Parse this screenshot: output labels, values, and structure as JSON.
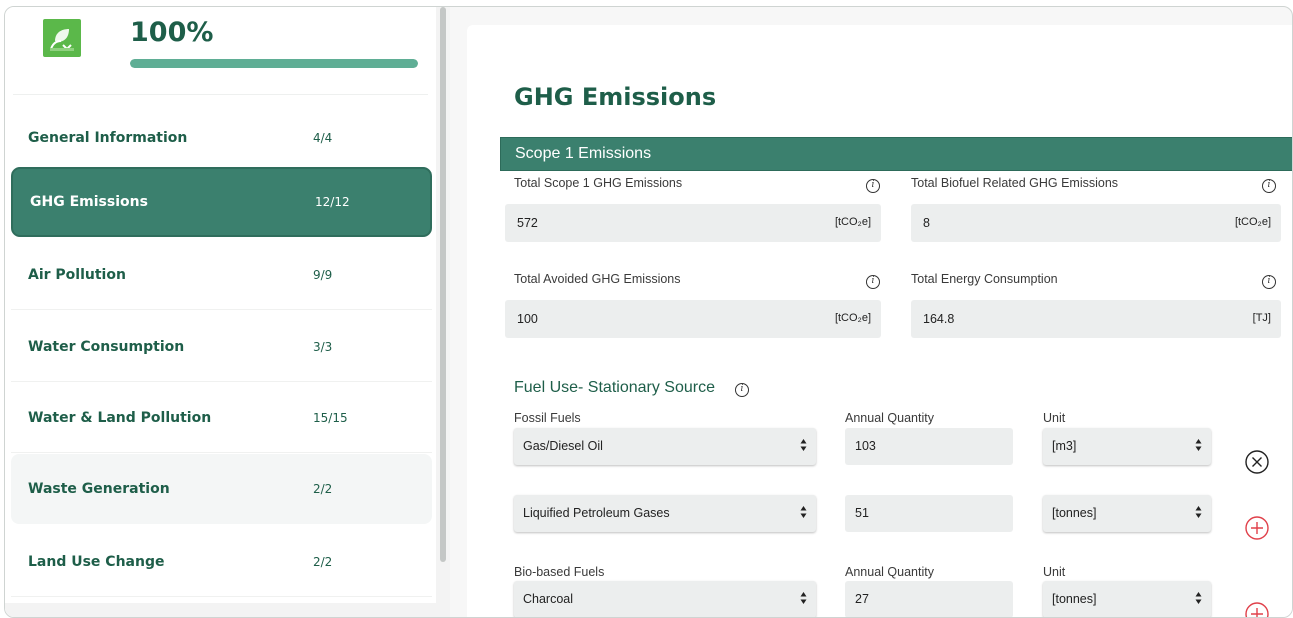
{
  "progress": {
    "percent_label": "100%",
    "fraction": 1.0
  },
  "sidebar": {
    "items": [
      {
        "label": "General Information",
        "count": "4/4"
      },
      {
        "label": "GHG Emissions",
        "count": "12/12"
      },
      {
        "label": "Air Pollution",
        "count": "9/9"
      },
      {
        "label": "Water Consumption",
        "count": "3/3"
      },
      {
        "label": "Water & Land Pollution",
        "count": "15/15"
      },
      {
        "label": "Waste Generation",
        "count": "2/2"
      },
      {
        "label": "Land Use Change",
        "count": "2/2"
      }
    ]
  },
  "main": {
    "title": "GHG Emissions",
    "scope1": {
      "header": "Scope 1 Emissions",
      "fields": [
        {
          "label": "Total Scope 1 GHG Emissions",
          "value": "572",
          "unit": "[tCO₂e]"
        },
        {
          "label": "Total Biofuel Related GHG Emissions",
          "value": "8",
          "unit": "[tCO₂e]"
        },
        {
          "label": "Total Avoided GHG Emissions",
          "value": "100",
          "unit": "[tCO₂e]"
        },
        {
          "label": "Total Energy Consumption",
          "value": "164.8",
          "unit": "[TJ]"
        }
      ]
    },
    "fuel": {
      "heading": "Fuel Use- Stationary Source",
      "fossil": {
        "col_fuel": "Fossil Fuels",
        "col_qty": "Annual Quantity",
        "col_unit": "Unit",
        "rows": [
          {
            "fuel": "Gas/Diesel Oil",
            "qty": "103",
            "unit": "[m3]"
          },
          {
            "fuel": "Liquified Petroleum Gases",
            "qty": "51",
            "unit": "[tonnes]"
          }
        ]
      },
      "bio": {
        "col_fuel": "Bio-based Fuels",
        "col_qty": "Annual Quantity",
        "col_unit": "Unit",
        "rows": [
          {
            "fuel": "Charcoal",
            "qty": "27",
            "unit": "[tonnes]"
          }
        ]
      }
    }
  },
  "icons": {
    "logo": "recycle-leaf-icon",
    "info": "info-icon",
    "remove": "close-circle-icon",
    "add": "plus-circle-icon",
    "select_arrows": "sort-arrows-icon"
  },
  "colors": {
    "brand_green": "#1e5e49",
    "active_nav": "#3b806e",
    "scope_bar": "#3b806e",
    "add_red": "#e0404a",
    "logo_green": "#5bb84a"
  }
}
